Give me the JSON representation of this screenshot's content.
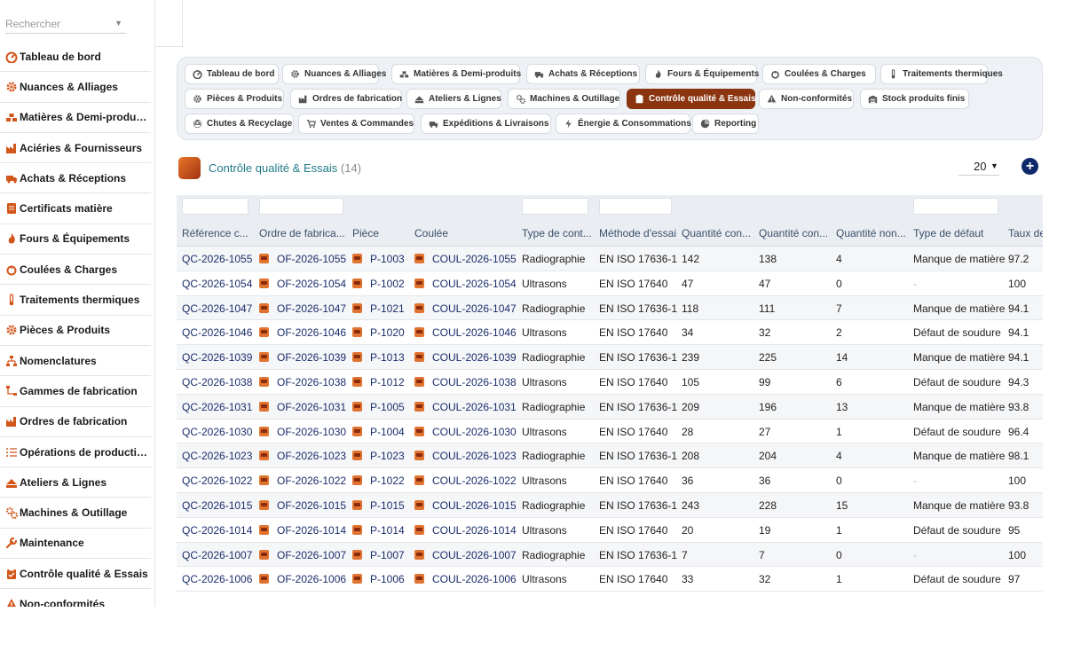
{
  "sidebar": {
    "search_placeholder": "Rechercher",
    "items": [
      {
        "label": "Tableau de bord",
        "icon": "dashboard-icon"
      },
      {
        "label": "Nuances & Alliages",
        "icon": "gear-icon"
      },
      {
        "label": "Matières & Demi-produits",
        "icon": "materials-icon"
      },
      {
        "label": "Aciéries & Fournisseurs",
        "icon": "factory-icon"
      },
      {
        "label": "Achats & Réceptions",
        "icon": "truck-icon"
      },
      {
        "label": "Certificats matière",
        "icon": "certificate-icon"
      },
      {
        "label": "Fours & Équipements",
        "icon": "flame-icon"
      },
      {
        "label": "Coulées & Charges",
        "icon": "fire-icon"
      },
      {
        "label": "Traitements thermiques",
        "icon": "thermometer-icon"
      },
      {
        "label": "Pièces & Produits",
        "icon": "cog-icon"
      },
      {
        "label": "Nomenclatures",
        "icon": "hierarchy-icon"
      },
      {
        "label": "Gammes de fabrication",
        "icon": "flow-icon"
      },
      {
        "label": "Ordres de fabrication",
        "icon": "factory-icon"
      },
      {
        "label": "Opérations de production",
        "icon": "list-icon"
      },
      {
        "label": "Ateliers & Lignes",
        "icon": "workshop-icon"
      },
      {
        "label": "Machines & Outillage",
        "icon": "cogs-icon"
      },
      {
        "label": "Maintenance",
        "icon": "wrench-icon"
      },
      {
        "label": "Contrôle qualité & Essais",
        "icon": "clipboard-icon"
      },
      {
        "label": "Non-conformités",
        "icon": "warning-icon"
      }
    ]
  },
  "tabs": [
    {
      "label": "Tableau de bord",
      "icon": "dashboard-icon",
      "active": false
    },
    {
      "label": "Nuances & Alliages",
      "icon": "gear-icon",
      "active": false
    },
    {
      "label": "Matières & Demi-produits",
      "icon": "materials-icon",
      "active": false
    },
    {
      "label": "Achats & Réceptions",
      "icon": "truck-icon",
      "active": false
    },
    {
      "label": "Fours & Équipements",
      "icon": "flame-icon",
      "active": false
    },
    {
      "label": "Coulées & Charges",
      "icon": "fire-icon",
      "active": false
    },
    {
      "label": "Traitements thermiques",
      "icon": "thermometer-icon",
      "active": false
    },
    {
      "label": "Pièces & Produits",
      "icon": "cog-icon",
      "active": false
    },
    {
      "label": "Ordres de fabrication",
      "icon": "factory-icon",
      "active": false
    },
    {
      "label": "Ateliers & Lignes",
      "icon": "workshop-icon",
      "active": false
    },
    {
      "label": "Machines & Outillage",
      "icon": "cogs-icon",
      "active": false
    },
    {
      "label": "Contrôle qualité & Essais",
      "icon": "clipboard-icon",
      "active": true
    },
    {
      "label": "Non-conformités",
      "icon": "warning-icon",
      "active": false
    },
    {
      "label": "Stock produits finis",
      "icon": "warehouse-icon",
      "active": false
    },
    {
      "label": "Chutes & Recyclage",
      "icon": "recycle-icon",
      "active": false
    },
    {
      "label": "Ventes & Commandes",
      "icon": "cart-icon",
      "active": false
    },
    {
      "label": "Expéditions & Livraisons",
      "icon": "truck-icon",
      "active": false
    },
    {
      "label": "Énergie & Consommations",
      "icon": "bolt-icon",
      "active": false
    },
    {
      "label": "Reporting",
      "icon": "chart-pie-icon",
      "active": false
    }
  ],
  "page": {
    "title": "Contrôle qualité & Essais",
    "count": "(14)",
    "page_size": "20",
    "add_icon": "plus-icon"
  },
  "colors": {
    "accent": "#8a3510",
    "link": "#1a2d6b",
    "title": "#1f7a87",
    "add_button": "#0f2a6b"
  },
  "table": {
    "headers": [
      "Référence contrôle",
      "Ordre de fabrication",
      "Pièce",
      "Coulée",
      "Type de contrôle",
      "Méthode d'essai",
      "Quantité contrôlée",
      "Quantité conforme",
      "Quantité non conforme",
      "Type de défaut",
      "Taux de conformité"
    ],
    "header_display": [
      "Référence c...",
      "Ordre de fabrica...",
      "Pièce",
      "Coulée",
      "Type de cont...",
      "Méthode d'essai",
      "Quantité con...",
      "Quantité con...",
      "Quantité non...",
      "Type de défaut",
      "Taux de"
    ],
    "rows": [
      [
        "QC-2026-1055",
        "OF-2026-1055",
        "P-1003",
        "COUL-2026-1055",
        "Radiographie",
        "EN ISO 17636-1",
        "142",
        "138",
        "4",
        "Manque de matière",
        "97.2"
      ],
      [
        "QC-2026-1054",
        "OF-2026-1054",
        "P-1002",
        "COUL-2026-1054",
        "Ultrasons",
        "EN ISO 17640",
        "47",
        "47",
        "0",
        "-",
        "100"
      ],
      [
        "QC-2026-1047",
        "OF-2026-1047",
        "P-1021",
        "COUL-2026-1047",
        "Radiographie",
        "EN ISO 17636-1",
        "118",
        "111",
        "7",
        "Manque de matière",
        "94.1"
      ],
      [
        "QC-2026-1046",
        "OF-2026-1046",
        "P-1020",
        "COUL-2026-1046",
        "Ultrasons",
        "EN ISO 17640",
        "34",
        "32",
        "2",
        "Défaut de soudure",
        "94.1"
      ],
      [
        "QC-2026-1039",
        "OF-2026-1039",
        "P-1013",
        "COUL-2026-1039",
        "Radiographie",
        "EN ISO 17636-1",
        "239",
        "225",
        "14",
        "Manque de matière",
        "94.1"
      ],
      [
        "QC-2026-1038",
        "OF-2026-1038",
        "P-1012",
        "COUL-2026-1038",
        "Ultrasons",
        "EN ISO 17640",
        "105",
        "99",
        "6",
        "Défaut de soudure",
        "94.3"
      ],
      [
        "QC-2026-1031",
        "OF-2026-1031",
        "P-1005",
        "COUL-2026-1031",
        "Radiographie",
        "EN ISO 17636-1",
        "209",
        "196",
        "13",
        "Manque de matière",
        "93.8"
      ],
      [
        "QC-2026-1030",
        "OF-2026-1030",
        "P-1004",
        "COUL-2026-1030",
        "Ultrasons",
        "EN ISO 17640",
        "28",
        "27",
        "1",
        "Défaut de soudure",
        "96.4"
      ],
      [
        "QC-2026-1023",
        "OF-2026-1023",
        "P-1023",
        "COUL-2026-1023",
        "Radiographie",
        "EN ISO 17636-1",
        "208",
        "204",
        "4",
        "Manque de matière",
        "98.1"
      ],
      [
        "QC-2026-1022",
        "OF-2026-1022",
        "P-1022",
        "COUL-2026-1022",
        "Ultrasons",
        "EN ISO 17640",
        "36",
        "36",
        "0",
        "-",
        "100"
      ],
      [
        "QC-2026-1015",
        "OF-2026-1015",
        "P-1015",
        "COUL-2026-1015",
        "Radiographie",
        "EN ISO 17636-1",
        "243",
        "228",
        "15",
        "Manque de matière",
        "93.8"
      ],
      [
        "QC-2026-1014",
        "OF-2026-1014",
        "P-1014",
        "COUL-2026-1014",
        "Ultrasons",
        "EN ISO 17640",
        "20",
        "19",
        "1",
        "Défaut de soudure",
        "95"
      ],
      [
        "QC-2026-1007",
        "OF-2026-1007",
        "P-1007",
        "COUL-2026-1007",
        "Radiographie",
        "EN ISO 17636-1",
        "7",
        "7",
        "0",
        "-",
        "100"
      ],
      [
        "QC-2026-1006",
        "OF-2026-1006",
        "P-1006",
        "COUL-2026-1006",
        "Ultrasons",
        "EN ISO 17640",
        "33",
        "32",
        "1",
        "Défaut de soudure",
        "97"
      ]
    ]
  }
}
